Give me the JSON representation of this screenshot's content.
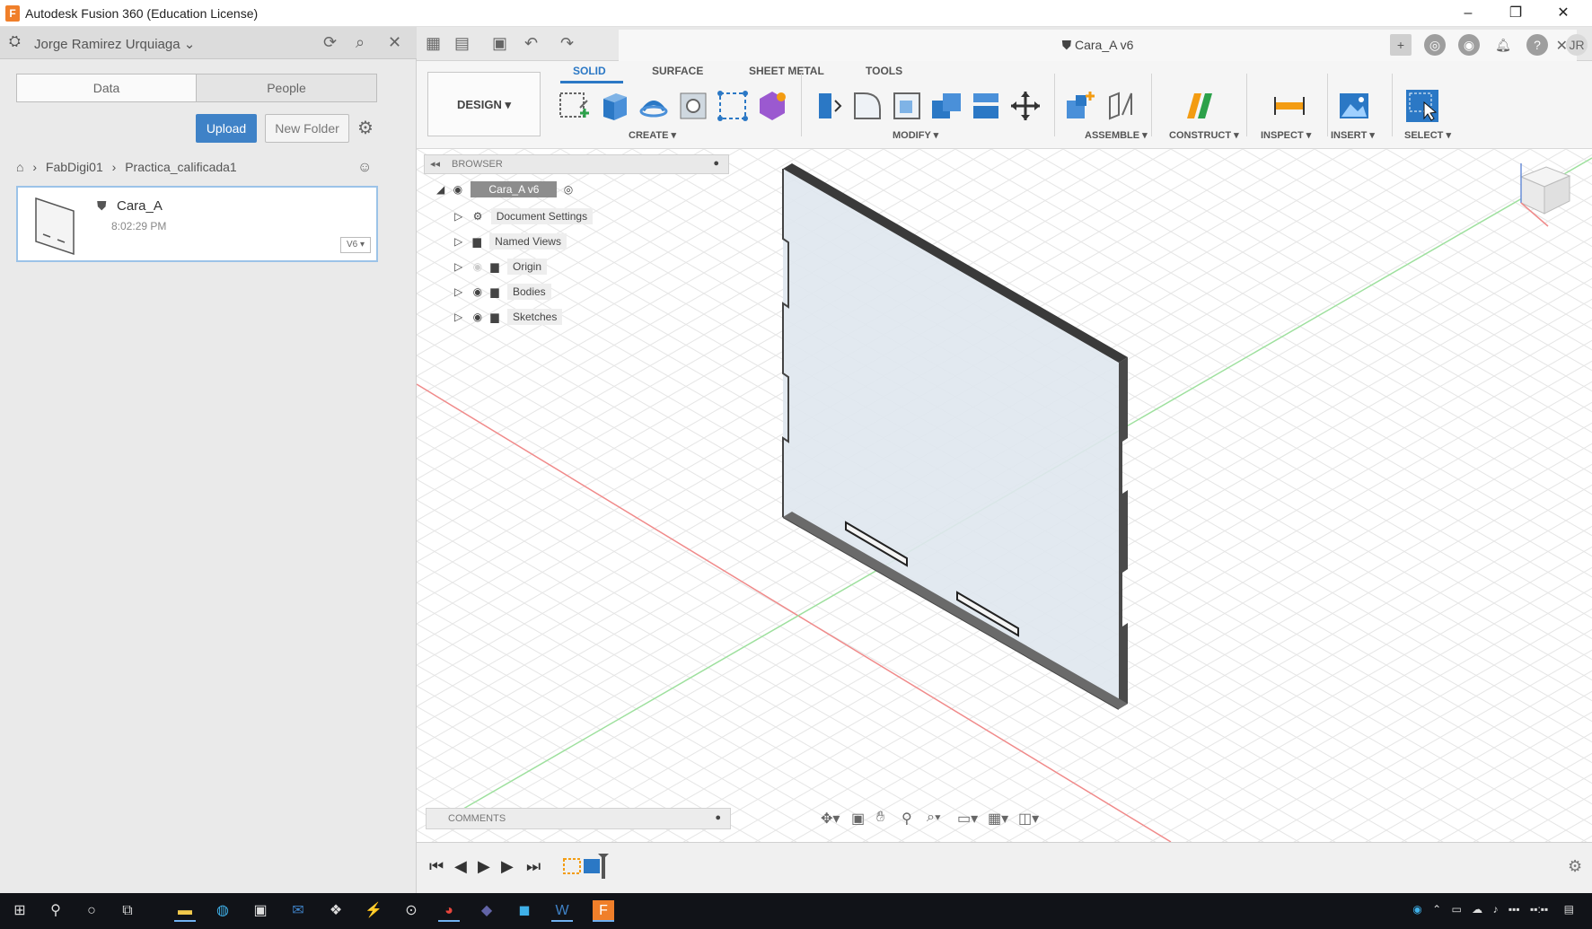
{
  "window": {
    "title": "Autodesk Fusion 360 (Education License)",
    "minimize": "–",
    "restore": "❐",
    "close": "✕"
  },
  "data_panel": {
    "user_name": "Jorge Ramirez Urquiaga",
    "tabs": [
      "Data",
      "People"
    ],
    "upload_label": "Upload",
    "new_folder_label": "New Folder",
    "breadcrumb": [
      "FabDigi01",
      "Practica_calificada1"
    ],
    "file": {
      "name": "Cara_A",
      "time": "8:02:29 PM",
      "version": "V6 ▾"
    }
  },
  "document": {
    "tab_title": "Cara_A v6"
  },
  "ribbon": {
    "workspace": "DESIGN ▾",
    "tabs": [
      "SOLID",
      "SURFACE",
      "SHEET METAL",
      "TOOLS"
    ],
    "groups": [
      "CREATE ▾",
      "MODIFY ▾",
      "ASSEMBLE ▾",
      "CONSTRUCT ▾",
      "INSPECT ▾",
      "INSERT ▾",
      "SELECT ▾"
    ]
  },
  "browser": {
    "title": "BROWSER",
    "root": "Cara_A v6",
    "items": [
      "Document Settings",
      "Named Views",
      "Origin",
      "Bodies",
      "Sketches"
    ]
  },
  "comments": {
    "label": "COMMENTS"
  },
  "colors": {
    "accent": "#2b78c5",
    "upload": "#3f82c7",
    "body_fill": "#dfe7ee",
    "body_edge": "#3a3a3a"
  }
}
